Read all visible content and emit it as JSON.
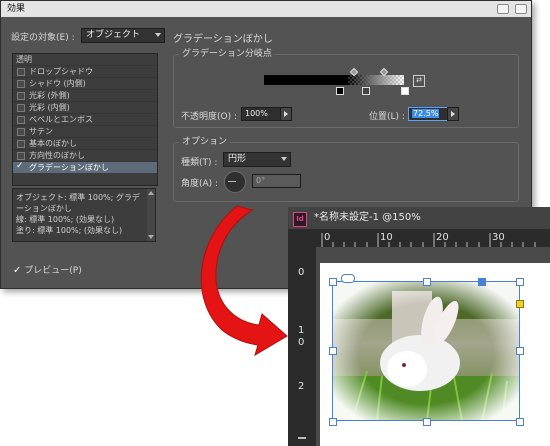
{
  "dialog": {
    "title": "効果",
    "target_label": "設定の対象(E) :",
    "target_value": "オブジェクト",
    "section_title": "グラデーションぼかし",
    "list_header": "透明",
    "effects": [
      {
        "label": "ドロップシャドウ",
        "checked": false
      },
      {
        "label": "シャドウ (内側)",
        "checked": false
      },
      {
        "label": "光彩 (外側)",
        "checked": false
      },
      {
        "label": "光彩 (内側)",
        "checked": false
      },
      {
        "label": "ベベルとエンボス",
        "checked": false
      },
      {
        "label": "サテン",
        "checked": false
      },
      {
        "label": "基本のぼかし",
        "checked": false
      },
      {
        "label": "方向性のぼかし",
        "checked": false
      },
      {
        "label": "グラデーションぼかし",
        "checked": true
      }
    ],
    "info_text": "オブジェクト: 標準 100%; グラデーションぼかし\n線: 標準 100%; (効果なし)\n塗り: 標準 100%; (効果なし)",
    "preview_label": "プレビュー(P)",
    "preview_checked": true,
    "gradient_group": {
      "title": "グラデーション分岐点",
      "opacity_label": "不透明度(O) :",
      "opacity_value": "100%",
      "position_label": "位置(L) :",
      "position_value": "72.5%"
    },
    "options_group": {
      "title": "オプション",
      "type_label": "種類(T) :",
      "type_value": "円形",
      "angle_label": "角度(A) :",
      "angle_value": "0°"
    }
  },
  "document": {
    "title": "*名称未設定-1 @150%",
    "app_icon": "Id",
    "h_ruler_labels": [
      "0",
      "10",
      "20",
      "30"
    ],
    "v_ruler_labels": [
      "0",
      "1\n0",
      "2"
    ],
    "image_subject": "white rabbit in grass"
  },
  "colors": {
    "dialog_bg": "#535353",
    "arrow": "#e41414",
    "selection": "#4a7fd6",
    "position_highlight": "#3d8ee6"
  }
}
